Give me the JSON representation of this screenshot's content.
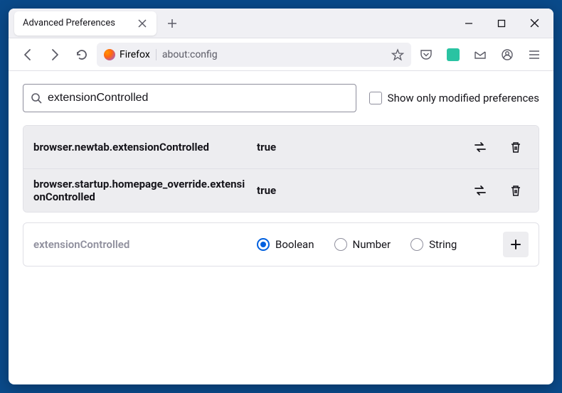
{
  "window": {
    "tab_title": "Advanced Preferences"
  },
  "toolbar": {
    "identity_label": "Firefox",
    "url": "about:config"
  },
  "search": {
    "value": "extensionControlled",
    "checkbox_label": "Show only modified preferences"
  },
  "prefs": [
    {
      "name": "browser.newtab.extensionControlled",
      "value": "true"
    },
    {
      "name": "browser.startup.homepage_override.extensionControlled",
      "value": "true"
    }
  ],
  "new_pref": {
    "name": "extensionControlled",
    "types": [
      "Boolean",
      "Number",
      "String"
    ],
    "selected": "Boolean"
  }
}
